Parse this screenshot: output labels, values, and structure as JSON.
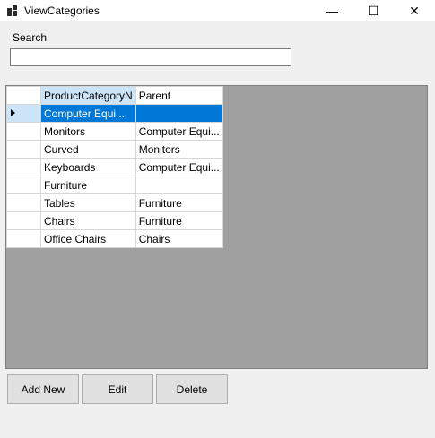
{
  "window": {
    "title": "ViewCategories",
    "minimize_glyph": "—",
    "maximize_glyph": "☐",
    "close_glyph": "✕"
  },
  "search": {
    "label": "Search",
    "value": ""
  },
  "grid": {
    "columns": [
      "ProductCategoryN",
      "Parent"
    ],
    "rows": [
      {
        "name": "Computer Equi...",
        "parent": ""
      },
      {
        "name": "Monitors",
        "parent": "Computer Equi..."
      },
      {
        "name": "Curved",
        "parent": "Monitors"
      },
      {
        "name": "Keyboards",
        "parent": "Computer Equi..."
      },
      {
        "name": "Furniture",
        "parent": ""
      },
      {
        "name": "Tables",
        "parent": "Furniture"
      },
      {
        "name": "Chairs",
        "parent": "Furniture"
      },
      {
        "name": "Office Chairs",
        "parent": "Chairs"
      }
    ],
    "selected_row_index": 0
  },
  "buttons": {
    "add_new": "Add New",
    "edit": "Edit",
    "delete": "Delete"
  }
}
